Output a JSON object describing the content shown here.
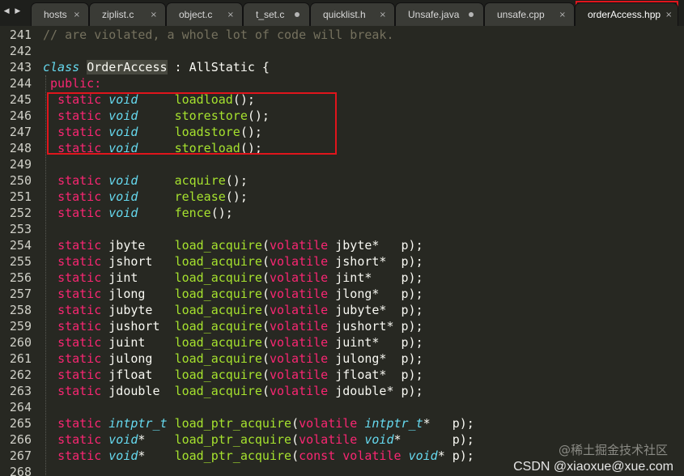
{
  "tabs": [
    {
      "label": "hosts",
      "state": "close"
    },
    {
      "label": "ziplist.c",
      "state": "close"
    },
    {
      "label": "object.c",
      "state": "close"
    },
    {
      "label": "t_set.c",
      "state": "modified"
    },
    {
      "label": "quicklist.h",
      "state": "close"
    },
    {
      "label": "Unsafe.java",
      "state": "modified"
    },
    {
      "label": "unsafe.cpp",
      "state": "close"
    },
    {
      "label": "orderAccess.hpp",
      "state": "close",
      "active": true
    }
  ],
  "glyphs": {
    "close": "×",
    "nav": "◀ ▶"
  },
  "lines": [
    {
      "n": "241",
      "tokens": [
        {
          "t": "// are violated, a whole lot of code will break.",
          "c": "c-comment"
        }
      ]
    },
    {
      "n": "242",
      "tokens": []
    },
    {
      "n": "243",
      "tokens": [
        {
          "t": "class",
          "c": "c-typet"
        },
        {
          "t": " "
        },
        {
          "t": "OrderAccess",
          "c": "c-cls"
        },
        {
          "t": " : AllStatic {"
        }
      ]
    },
    {
      "n": "244",
      "tokens": [
        {
          "t": " public:",
          "c": "c-kw"
        }
      ]
    },
    {
      "n": "245",
      "tokens": [
        {
          "t": "  "
        },
        {
          "t": "static",
          "c": "c-kw"
        },
        {
          "t": " "
        },
        {
          "t": "void",
          "c": "c-type"
        },
        {
          "t": "     "
        },
        {
          "t": "loadload",
          "c": "c-func"
        },
        {
          "t": "();"
        }
      ]
    },
    {
      "n": "246",
      "tokens": [
        {
          "t": "  "
        },
        {
          "t": "static",
          "c": "c-kw"
        },
        {
          "t": " "
        },
        {
          "t": "void",
          "c": "c-type"
        },
        {
          "t": "     "
        },
        {
          "t": "storestore",
          "c": "c-func"
        },
        {
          "t": "();"
        }
      ]
    },
    {
      "n": "247",
      "tokens": [
        {
          "t": "  "
        },
        {
          "t": "static",
          "c": "c-kw"
        },
        {
          "t": " "
        },
        {
          "t": "void",
          "c": "c-type"
        },
        {
          "t": "     "
        },
        {
          "t": "loadstore",
          "c": "c-func"
        },
        {
          "t": "();"
        }
      ]
    },
    {
      "n": "248",
      "tokens": [
        {
          "t": "  "
        },
        {
          "t": "static",
          "c": "c-kw"
        },
        {
          "t": " "
        },
        {
          "t": "void",
          "c": "c-type"
        },
        {
          "t": "     "
        },
        {
          "t": "storeload",
          "c": "c-func"
        },
        {
          "t": "();"
        }
      ]
    },
    {
      "n": "249",
      "tokens": []
    },
    {
      "n": "250",
      "tokens": [
        {
          "t": "  "
        },
        {
          "t": "static",
          "c": "c-kw"
        },
        {
          "t": " "
        },
        {
          "t": "void",
          "c": "c-type"
        },
        {
          "t": "     "
        },
        {
          "t": "acquire",
          "c": "c-func"
        },
        {
          "t": "();"
        }
      ]
    },
    {
      "n": "251",
      "tokens": [
        {
          "t": "  "
        },
        {
          "t": "static",
          "c": "c-kw"
        },
        {
          "t": " "
        },
        {
          "t": "void",
          "c": "c-type"
        },
        {
          "t": "     "
        },
        {
          "t": "release",
          "c": "c-func"
        },
        {
          "t": "();"
        }
      ]
    },
    {
      "n": "252",
      "tokens": [
        {
          "t": "  "
        },
        {
          "t": "static",
          "c": "c-kw"
        },
        {
          "t": " "
        },
        {
          "t": "void",
          "c": "c-type"
        },
        {
          "t": "     "
        },
        {
          "t": "fence",
          "c": "c-func"
        },
        {
          "t": "();"
        }
      ]
    },
    {
      "n": "253",
      "tokens": []
    },
    {
      "n": "254",
      "tokens": [
        {
          "t": "  "
        },
        {
          "t": "static",
          "c": "c-kw"
        },
        {
          "t": " jbyte    "
        },
        {
          "t": "load_acquire",
          "c": "c-func"
        },
        {
          "t": "("
        },
        {
          "t": "volatile",
          "c": "c-kw"
        },
        {
          "t": " jbyte*   p);"
        }
      ]
    },
    {
      "n": "255",
      "tokens": [
        {
          "t": "  "
        },
        {
          "t": "static",
          "c": "c-kw"
        },
        {
          "t": " jshort   "
        },
        {
          "t": "load_acquire",
          "c": "c-func"
        },
        {
          "t": "("
        },
        {
          "t": "volatile",
          "c": "c-kw"
        },
        {
          "t": " jshort*  p);"
        }
      ]
    },
    {
      "n": "256",
      "tokens": [
        {
          "t": "  "
        },
        {
          "t": "static",
          "c": "c-kw"
        },
        {
          "t": " jint     "
        },
        {
          "t": "load_acquire",
          "c": "c-func"
        },
        {
          "t": "("
        },
        {
          "t": "volatile",
          "c": "c-kw"
        },
        {
          "t": " jint*    p);"
        }
      ]
    },
    {
      "n": "257",
      "tokens": [
        {
          "t": "  "
        },
        {
          "t": "static",
          "c": "c-kw"
        },
        {
          "t": " jlong    "
        },
        {
          "t": "load_acquire",
          "c": "c-func"
        },
        {
          "t": "("
        },
        {
          "t": "volatile",
          "c": "c-kw"
        },
        {
          "t": " jlong*   p);"
        }
      ]
    },
    {
      "n": "258",
      "tokens": [
        {
          "t": "  "
        },
        {
          "t": "static",
          "c": "c-kw"
        },
        {
          "t": " jubyte   "
        },
        {
          "t": "load_acquire",
          "c": "c-func"
        },
        {
          "t": "("
        },
        {
          "t": "volatile",
          "c": "c-kw"
        },
        {
          "t": " jubyte*  p);"
        }
      ]
    },
    {
      "n": "259",
      "tokens": [
        {
          "t": "  "
        },
        {
          "t": "static",
          "c": "c-kw"
        },
        {
          "t": " jushort  "
        },
        {
          "t": "load_acquire",
          "c": "c-func"
        },
        {
          "t": "("
        },
        {
          "t": "volatile",
          "c": "c-kw"
        },
        {
          "t": " jushort* p);"
        }
      ]
    },
    {
      "n": "260",
      "tokens": [
        {
          "t": "  "
        },
        {
          "t": "static",
          "c": "c-kw"
        },
        {
          "t": " juint    "
        },
        {
          "t": "load_acquire",
          "c": "c-func"
        },
        {
          "t": "("
        },
        {
          "t": "volatile",
          "c": "c-kw"
        },
        {
          "t": " juint*   p);"
        }
      ]
    },
    {
      "n": "261",
      "tokens": [
        {
          "t": "  "
        },
        {
          "t": "static",
          "c": "c-kw"
        },
        {
          "t": " julong   "
        },
        {
          "t": "load_acquire",
          "c": "c-func"
        },
        {
          "t": "("
        },
        {
          "t": "volatile",
          "c": "c-kw"
        },
        {
          "t": " julong*  p);"
        }
      ]
    },
    {
      "n": "262",
      "tokens": [
        {
          "t": "  "
        },
        {
          "t": "static",
          "c": "c-kw"
        },
        {
          "t": " jfloat   "
        },
        {
          "t": "load_acquire",
          "c": "c-func"
        },
        {
          "t": "("
        },
        {
          "t": "volatile",
          "c": "c-kw"
        },
        {
          "t": " jfloat*  p);"
        }
      ]
    },
    {
      "n": "263",
      "tokens": [
        {
          "t": "  "
        },
        {
          "t": "static",
          "c": "c-kw"
        },
        {
          "t": " jdouble  "
        },
        {
          "t": "load_acquire",
          "c": "c-func"
        },
        {
          "t": "("
        },
        {
          "t": "volatile",
          "c": "c-kw"
        },
        {
          "t": " jdouble* p);"
        }
      ]
    },
    {
      "n": "264",
      "tokens": []
    },
    {
      "n": "265",
      "tokens": [
        {
          "t": "  "
        },
        {
          "t": "static",
          "c": "c-kw"
        },
        {
          "t": " "
        },
        {
          "t": "intptr_t",
          "c": "c-type"
        },
        {
          "t": " "
        },
        {
          "t": "load_ptr_acquire",
          "c": "c-func"
        },
        {
          "t": "("
        },
        {
          "t": "volatile",
          "c": "c-kw"
        },
        {
          "t": " "
        },
        {
          "t": "intptr_t",
          "c": "c-type"
        },
        {
          "t": "*   p);"
        }
      ]
    },
    {
      "n": "266",
      "tokens": [
        {
          "t": "  "
        },
        {
          "t": "static",
          "c": "c-kw"
        },
        {
          "t": " "
        },
        {
          "t": "void",
          "c": "c-type"
        },
        {
          "t": "*    "
        },
        {
          "t": "load_ptr_acquire",
          "c": "c-func"
        },
        {
          "t": "("
        },
        {
          "t": "volatile",
          "c": "c-kw"
        },
        {
          "t": " "
        },
        {
          "t": "void",
          "c": "c-type"
        },
        {
          "t": "*       p);"
        }
      ]
    },
    {
      "n": "267",
      "tokens": [
        {
          "t": "  "
        },
        {
          "t": "static",
          "c": "c-kw"
        },
        {
          "t": " "
        },
        {
          "t": "void",
          "c": "c-type"
        },
        {
          "t": "*    "
        },
        {
          "t": "load_ptr_acquire",
          "c": "c-func"
        },
        {
          "t": "("
        },
        {
          "t": "const",
          "c": "c-kw"
        },
        {
          "t": " "
        },
        {
          "t": "volatile",
          "c": "c-kw"
        },
        {
          "t": " "
        },
        {
          "t": "void",
          "c": "c-type"
        },
        {
          "t": "* p);"
        }
      ]
    },
    {
      "n": "268",
      "tokens": []
    }
  ],
  "watermark": {
    "line1": "@稀土掘金技术社区",
    "line2": "CSDN @xiaoxue@xue.com"
  },
  "colors": {
    "background": "#272822",
    "comment": "#75715e",
    "keyword": "#f92672",
    "type": "#66d9ef",
    "function": "#a6e22e",
    "highlight": "#e0151c"
  }
}
